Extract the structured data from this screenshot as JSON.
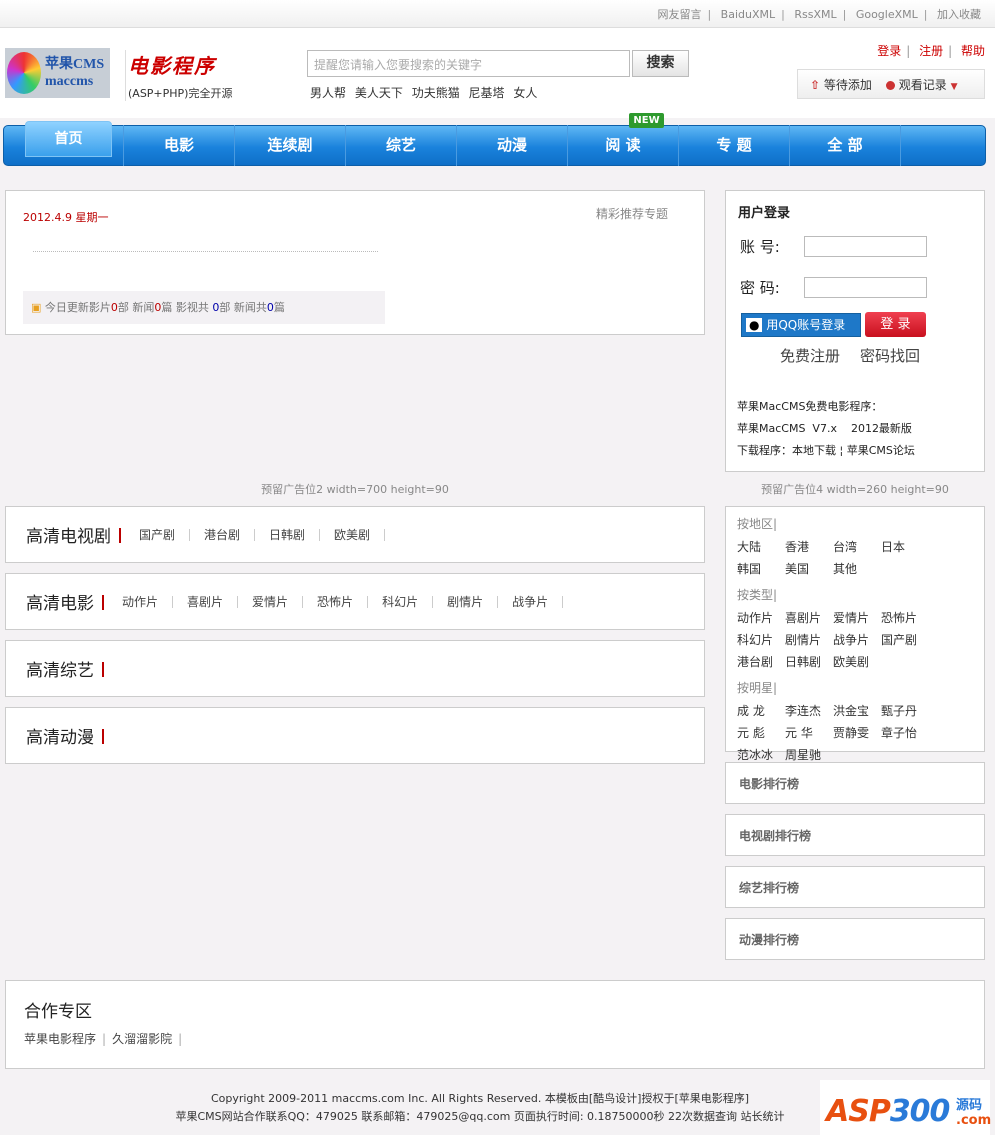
{
  "top_links": [
    "网友留言",
    "BaiduXML",
    "RssXML",
    "GoogleXML",
    "加入收藏"
  ],
  "logo": {
    "brand": "苹果CMS",
    "sub": "maccms",
    "title": "电影程序",
    "tagline": "(ASP+PHP)完全开源"
  },
  "search": {
    "placeholder": "提醒您请输入您要搜索的关键字",
    "button": "搜索",
    "hot_words": [
      "男人帮",
      "美人天下",
      "功夫熊猫",
      "尼基塔",
      "女人"
    ]
  },
  "user_links": [
    "登录",
    "注册",
    "帮助"
  ],
  "toolbox": {
    "pending": "等待添加",
    "history": "观看记录"
  },
  "nav": {
    "items": [
      "首页",
      "电影",
      "连续剧",
      "综艺",
      "动漫",
      "阅 读",
      "专 题",
      "全 部"
    ],
    "new_badge": "NEW"
  },
  "info": {
    "date": "2012.4.9 星期一",
    "featured": "精彩推荐专题",
    "stats": {
      "p1": "今日更新影片",
      "v1": "0",
      "p2": "部 新闻",
      "v2": "0",
      "p3": "篇 影视共 ",
      "v3": "0",
      "p4": "部 新闻共",
      "v4": "0",
      "p5": "篇"
    }
  },
  "login": {
    "title": "用户登录",
    "account_label": "账 号:",
    "password_label": "密 码:",
    "qq_button": "用QQ账号登录",
    "login_button": "登 录",
    "register": "免费注册",
    "recover": "密码找回",
    "line1": "苹果MacCMS免费电影程序：",
    "line2": "苹果MacCMS  V7.x    2012最新版",
    "line3": "下载程序：本地下载 ¦ 苹果CMS论坛"
  },
  "ads": {
    "left": "预留广告位2 width=700 height=90",
    "right": "预留广告位4 width=260 height=90"
  },
  "categories": [
    {
      "title": "高清电视剧",
      "links": [
        "国产剧",
        "港台剧",
        "日韩剧",
        "欧美剧"
      ]
    },
    {
      "title": "高清电影",
      "links": [
        "动作片",
        "喜剧片",
        "爱情片",
        "恐怖片",
        "科幻片",
        "剧情片",
        "战争片"
      ]
    },
    {
      "title": "高清综艺",
      "links": []
    },
    {
      "title": "高清动漫",
      "links": []
    }
  ],
  "filters": [
    {
      "label": "按地区|",
      "items": [
        "大陆",
        "香港",
        "台湾",
        "日本",
        "韩国",
        "美国",
        "其他"
      ]
    },
    {
      "label": "按类型|",
      "items": [
        "动作片",
        "喜剧片",
        "爱情片",
        "恐怖片",
        "科幻片",
        "剧情片",
        "战争片",
        "国产剧",
        "港台剧",
        "日韩剧",
        "欧美剧"
      ]
    },
    {
      "label": "按明星|",
      "items": [
        "成 龙",
        "李连杰",
        "洪金宝",
        "甄子丹",
        "元 彪",
        "元 华",
        "贾静雯",
        "章子怡",
        "范冰冰",
        "周星驰"
      ]
    }
  ],
  "rankings": [
    "电影排行榜",
    "电视剧排行榜",
    "综艺排行榜",
    "动漫排行榜"
  ],
  "partners": {
    "title": "合作专区",
    "links": [
      "苹果电影程序",
      "久溜溜影院"
    ]
  },
  "footer": {
    "line1": "Copyright 2009-2011 maccms.com Inc. All Rights Reserved. 本模板由[酷鸟设计]授权于[苹果电影程序]",
    "line2": "苹果CMS网站合作联系QQ：479025 联系邮箱：479025@qq.com 页面执行时间: 0.18750000秒  22次数据查询 站长统计",
    "watermark": "ASP300源码 .com"
  }
}
